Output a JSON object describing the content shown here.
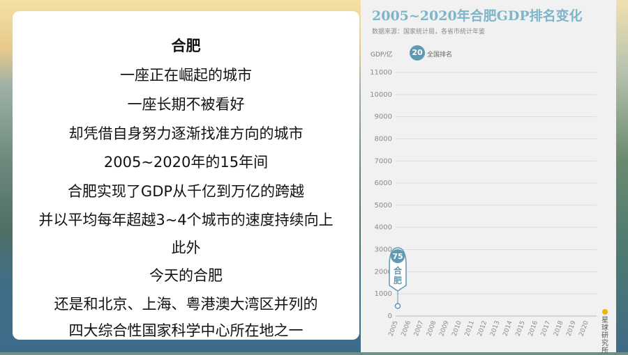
{
  "card": {
    "lines": [
      "合肥",
      "一座正在崛起的城市",
      "一座长期不被看好",
      "却凭借自身努力逐渐找准方向的城市",
      "2005~2020年的15年间",
      "合肥实现了GDP从千亿到万亿的跨越",
      "并以平均每年超越3~4个城市的速度持续向上",
      "此外",
      "今天的合肥",
      "还是和北京、上海、粤港澳大湾区并列的",
      "四大综合性国家科学中心所在地之一"
    ]
  },
  "chart": {
    "title": "2005~2020年合肥GDP排名变化",
    "source": "数据来源：国家统计局，各省市统计年鉴",
    "y_unit": "GDP/亿",
    "rank_badge": "20",
    "rank_label": "全国排名",
    "marker_rank": "75",
    "marker_city": "合肥",
    "brand": "星球研究所"
  },
  "colors": {
    "title": "#7fb5c9",
    "accent": "#5f99b2",
    "brand_dot": "#f0b400"
  },
  "chart_data": {
    "type": "line",
    "title": "2005~2020年合肥GDP排名变化",
    "ylabel": "GDP/亿",
    "ylim": [
      0,
      11000
    ],
    "yticks": [
      0,
      1000,
      2000,
      3000,
      4000,
      5000,
      6000,
      7000,
      8000,
      9000,
      10000,
      11000
    ],
    "x": [
      "2005",
      "2006",
      "2007",
      "2008",
      "2009",
      "2010",
      "2011",
      "2012",
      "2013",
      "2014",
      "2015",
      "2016",
      "2017",
      "2018",
      "2019",
      "2020"
    ],
    "series": [
      {
        "name": "合肥",
        "points": [
          {
            "x": "2005",
            "y": 450,
            "rank": 75
          }
        ]
      }
    ],
    "grid": true
  }
}
